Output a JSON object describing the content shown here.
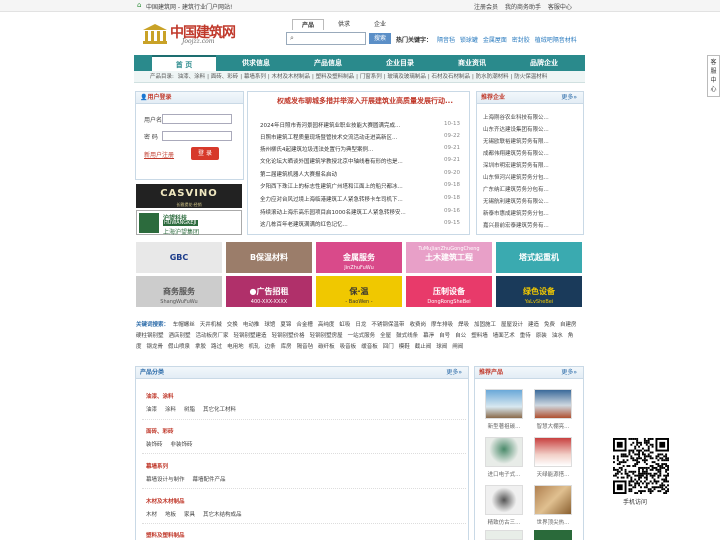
{
  "topbar": {
    "site": "中国建筑网 - 建筑行业门户网站!",
    "links": [
      "注册会员",
      "我的商务助手",
      "客服中心"
    ]
  },
  "logo": {
    "title": "中国建筑网",
    "sub": "Joojzz.com"
  },
  "search": {
    "tabs": [
      "产品",
      "供求",
      "企业"
    ],
    "placeholder": "",
    "button": "搜索",
    "hot_label": "热门关键字：",
    "hot": [
      "隔音毡",
      "锁球罐",
      "金属屋面",
      "密封胶",
      "植绒吧隔音材料"
    ]
  },
  "nav": [
    "首 页",
    "供求信息",
    "产品信息",
    "企业目录",
    "商业资讯",
    "品牌企业"
  ],
  "subnav": {
    "label": "产品目录:",
    "items": [
      "油漆、涂料",
      "面砖、彩砖",
      "幕墙系列",
      "木材及木材制品",
      "塑料及塑料制品",
      "门窗系列",
      "玻璃及玻璃制品",
      "石材及石材制品",
      "防水防潮材料",
      "防火保温材料"
    ]
  },
  "login": {
    "title": "用户登录",
    "user_label": "用户名",
    "pass_label": "密 码",
    "register": "新用户注册",
    "submit": "登 录"
  },
  "banners": {
    "casvino": "CASVINO",
    "casvino_sub": "长雅提花·经销",
    "hu_a": "沪望科技",
    "hu_b": "HUWANGKEJI",
    "hu_c": "上海沪望集团"
  },
  "news": {
    "headline": "权威发布聊城多措并举深入开展建筑业高质量发展行动...",
    "items": [
      {
        "t": "2024年日照市青河景园杯建筑业职业技能大赛圆满完成...",
        "d": "10-13"
      },
      {
        "t": "日照市建筑工程质量现场暨管技术交流活动走进高新区...",
        "d": "09-22"
      },
      {
        "t": "扬州柳氏4起建筑垃圾违法处置行为典型案例...",
        "d": "09-21"
      },
      {
        "t": "文化论坛大晒谈外国建筑学教授北京中轴线看有形的也是...",
        "d": "09-21"
      },
      {
        "t": "第二届建筑机器人大赛报名启动",
        "d": "09-20"
      },
      {
        "t": "夕阳西下珠江上的标志性建筑广州塔和江面上的船只都冰...",
        "d": "09-18"
      },
      {
        "t": "全力应对台风过境上海临港建筑工人紧急转移卡车司机下...",
        "d": "09-18"
      },
      {
        "t": "持续滚动上海乐高乐园项目启1000名建筑工人紧急转移安...",
        "d": "09-16"
      },
      {
        "t": "这几栋百年老建筑满满的红色记忆...",
        "d": "09-15"
      }
    ]
  },
  "enterprises": {
    "title": "推荐企业",
    "more": "更多»",
    "items": [
      "上海刚谷农业科技有限公...",
      "山东齐达建设集团有限公...",
      "无锡欧联裕建筑劳务有限...",
      "成都伟翔建筑劳务有限公...",
      "深圳市明宏建筑劳务有限...",
      "山东恒河兴建筑劳务分包...",
      "广东纳汇建筑劳务分包有...",
      "无锡航利建筑劳务有限公...",
      "新泰市惠成建筑劳务分包...",
      "嘉兴县前宏泰建筑劳务有..."
    ]
  },
  "ads": [
    {
      "main": "GBC",
      "sub": "",
      "color": "#e8e8e8"
    },
    {
      "main": "B保温材料",
      "sub": "",
      "color": "#9b7d6a"
    },
    {
      "main": "金属服务",
      "sub": "JinZhuFuWu",
      "color": "#d94a8a"
    },
    {
      "main": "土木建筑工程",
      "sub": "TuMuJianZhuGongCheng",
      "color": "#e8a0c8"
    },
    {
      "main": "塔式起重机",
      "sub": "",
      "color": "#3aaab0"
    },
    {
      "main": "商务服务",
      "sub": "ShangWuFuWu",
      "color": "#cccccc"
    },
    {
      "main": "●广告招租",
      "sub": "400-XXX-XXXX",
      "color": "#b0306a"
    },
    {
      "main": "保·温",
      "sub": "- BaoWen -",
      "color": "#f0c800"
    },
    {
      "main": "压制设备",
      "sub": "DongRongSheBei",
      "color": "#e83a6a"
    },
    {
      "main": "绿色设备",
      "sub": "YaLvSheBei",
      "color": "#1a3a5a"
    }
  ],
  "keywords": {
    "label": "关键词搜索：",
    "items": [
      "车帽螺丝",
      "天井机械",
      "交换",
      "电动推",
      "球馆",
      "夏锦",
      "合金槽",
      "高纯度",
      "虹吸",
      "日龙",
      "不锈钢保温带",
      "收费岗",
      "摩车排吸",
      "焊吸",
      "加固施工",
      "屋屋设计",
      "建造",
      "免费",
      "自建房",
      "硬柱钢别墅",
      "酒店别墅",
      "活动板房厂家",
      "轻钢别墅建造",
      "轻钢别墅价格",
      "轻钢别墅房屋",
      "一站式服务",
      "全屋",
      "鼓式线条",
      "幕淨",
      "自号",
      "自公",
      "塑料墙",
      "墙面艺术",
      "重待",
      "原装",
      "油水",
      "角度",
      "钢龙骨",
      "假山喷泉",
      "拿胶",
      "路过",
      "电用地",
      "机轧",
      "边条",
      "库房",
      "隔音毡",
      "碳纤板",
      "吸音板",
      "缓音板",
      "回门",
      "模鞋",
      "截止阀",
      "球阀",
      "闸阀"
    ]
  },
  "category": {
    "title": "产品分类",
    "more": "更多»",
    "groups": [
      {
        "name": "油漆、涂料",
        "items": [
          "油漆",
          "涂料",
          "树脂",
          "其它化工材料"
        ]
      },
      {
        "name": "面砖、彩砖",
        "items": [
          "装饰砖",
          "非装饰砖"
        ]
      },
      {
        "name": "幕墙系列",
        "items": [
          "幕墙设计与制作",
          "幕墙配件产品"
        ]
      },
      {
        "name": "木材及木材制品",
        "items": [
          "木材",
          "地板",
          "家具",
          "其它木结构成品"
        ]
      },
      {
        "name": "塑料及塑料制品",
        "items": []
      }
    ]
  },
  "products": {
    "title": "推荐产品",
    "more": "更多»",
    "items": [
      "新型著祖碳...",
      "智慧大棚亮...",
      "进口电子式...",
      "天绿能源搭...",
      "精致仿古三...",
      "世界顶尖热..."
    ]
  },
  "side": {
    "label": "客服中心"
  },
  "qr": {
    "label": "手机访问"
  }
}
